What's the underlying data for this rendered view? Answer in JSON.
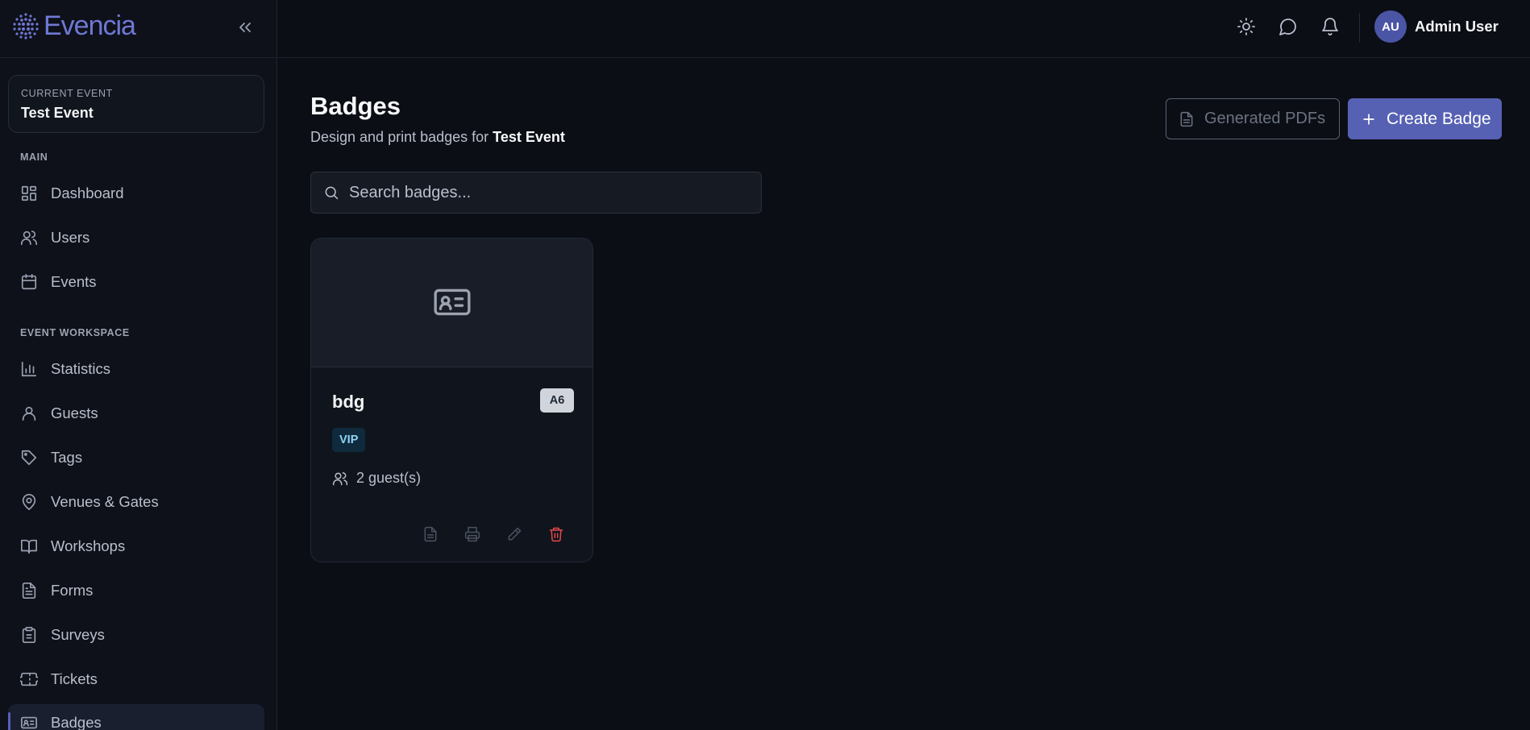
{
  "app": {
    "logo_text": "Evencia"
  },
  "sidebar": {
    "current_event_label": "CURRENT EVENT",
    "current_event_name": "Test Event",
    "sections": [
      {
        "label": "MAIN",
        "items": [
          {
            "label": "Dashboard",
            "icon": "dashboard-icon"
          },
          {
            "label": "Users",
            "icon": "users-icon"
          },
          {
            "label": "Events",
            "icon": "calendar-icon"
          }
        ]
      },
      {
        "label": "EVENT WORKSPACE",
        "items": [
          {
            "label": "Statistics",
            "icon": "bar-chart-icon"
          },
          {
            "label": "Guests",
            "icon": "user-icon"
          },
          {
            "label": "Tags",
            "icon": "tag-icon"
          },
          {
            "label": "Venues & Gates",
            "icon": "map-pin-icon"
          },
          {
            "label": "Workshops",
            "icon": "book-open-icon"
          },
          {
            "label": "Forms",
            "icon": "file-text-icon"
          },
          {
            "label": "Surveys",
            "icon": "clipboard-icon"
          },
          {
            "label": "Tickets",
            "icon": "ticket-icon"
          },
          {
            "label": "Badges",
            "icon": "id-card-icon",
            "active": true
          }
        ]
      }
    ]
  },
  "header": {
    "user_initials": "AU",
    "user_name": "Admin User",
    "icons": [
      "sun-icon",
      "message-icon",
      "bell-icon"
    ]
  },
  "main": {
    "title": "Badges",
    "subtitle_prefix": "Design and print badges for ",
    "subtitle_event": "Test Event",
    "generated_pdfs_label": "Generated PDFs",
    "create_badge_label": "Create Badge",
    "search_placeholder": "Search badges...",
    "cards": [
      {
        "name": "bdg",
        "size": "A6",
        "tag": "VIP",
        "guests": "2 guest(s)",
        "actions": [
          "pdf-icon",
          "print-icon",
          "edit-icon",
          "trash-icon"
        ]
      }
    ]
  },
  "colors": {
    "background": "#0b0e15",
    "sidebar": "#0e1119",
    "accent": "#5661b3",
    "danger": "#e5484d",
    "tag_bg": "#0f2a3c",
    "tag_text": "#8fd3f5"
  }
}
